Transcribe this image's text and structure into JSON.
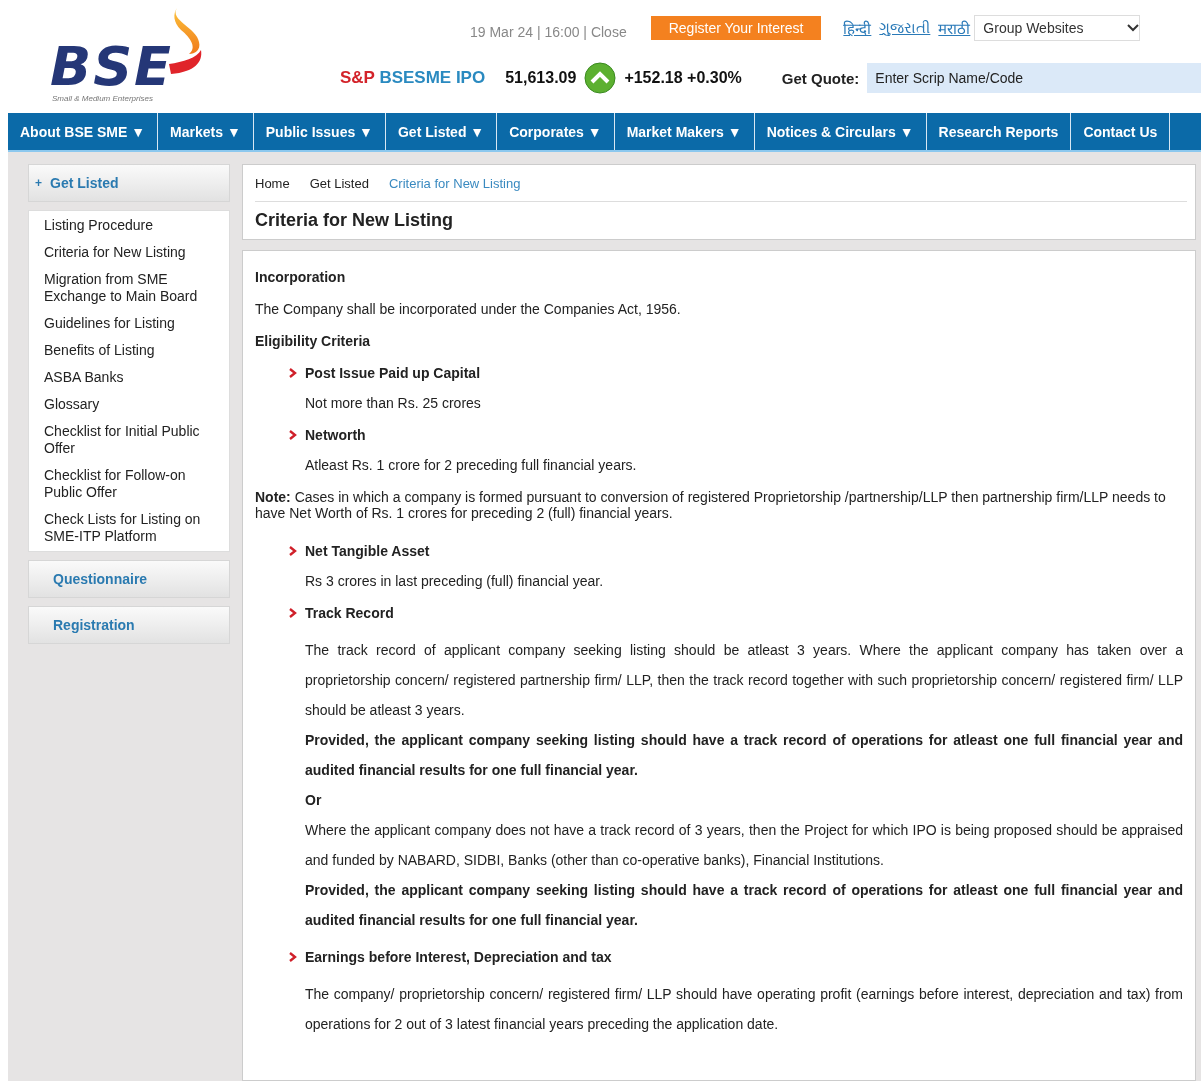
{
  "header": {
    "logo": {
      "wordmark": "BSE",
      "tagline": "Small & Medium Enterprises"
    },
    "market_status": "19 Mar 24 | 16:00 | Close",
    "register_button": "Register Your Interest",
    "language_links": [
      "हिन्दी",
      "ગુજરાતી",
      "मराठी"
    ],
    "group_websites": "Group Websites",
    "index": {
      "prefix": "S&P",
      "name": "BSESME IPO",
      "value": "51,613.09",
      "rising": true,
      "change": "+152.18 +0.30%"
    },
    "quote": {
      "label": "Get Quote:",
      "placeholder": "Enter Scrip Name/Code"
    }
  },
  "nav": [
    "About BSE SME ▼",
    "Markets ▼",
    "Public Issues ▼",
    "Get Listed ▼",
    "Corporates ▼",
    "Market Makers ▼",
    "Notices & Circulars ▼",
    "Research Reports",
    "Contact Us"
  ],
  "sidebar": {
    "section": {
      "marker": "+",
      "title": "Get Listed",
      "expanded": true
    },
    "items": [
      {
        "label": "Listing Procedure",
        "selected": false
      },
      {
        "label": "Criteria for New Listing",
        "selected": false
      },
      {
        "label": "Migration from SME Exchange to Main Board",
        "selected": false
      },
      {
        "label": "Guidelines for Listing",
        "selected": false
      },
      {
        "label": "Benefits of Listing",
        "selected": false
      },
      {
        "label": "ASBA Banks",
        "selected": false
      },
      {
        "label": "Glossary",
        "selected": false
      },
      {
        "label": "Checklist for Initial Public Offer",
        "selected": false
      },
      {
        "label": "Checklist for Follow-on Public Offer",
        "selected": false
      },
      {
        "label": "Check Lists for Listing on SME-ITP Platform",
        "selected": false
      }
    ],
    "other_sections": [
      "Questionnaire",
      "Registration"
    ]
  },
  "breadcrumb": [
    {
      "label": "Home",
      "current": false
    },
    {
      "label": "Get Listed",
      "current": false
    },
    {
      "label": "Criteria for New Listing",
      "current": true
    }
  ],
  "page_title": "Criteria for New Listing",
  "content": [
    {
      "kind": "heading",
      "text": "Incorporation"
    },
    {
      "kind": "para",
      "text": "The Company shall be incorporated under the Companies Act, 1956."
    },
    {
      "kind": "heading",
      "text": "Eligibility Criteria"
    },
    {
      "kind": "bullet",
      "text": "Post Issue Paid up Capital"
    },
    {
      "kind": "detail",
      "text": "Not more than Rs. 25 crores"
    },
    {
      "kind": "bullet",
      "text": "Networth"
    },
    {
      "kind": "detail",
      "text": "Atleast Rs. 1 crore for 2 preceding full financial years."
    },
    {
      "kind": "note",
      "text": "**Note:** Cases in which a company is formed pursuant to conversion of registered Proprietorship /partnership/LLP then partnership firm/LLP needs to have Net Worth of Rs. 1 crores for preceding 2 (full) financial years."
    },
    {
      "kind": "bullet",
      "text": "Net Tangible Asset"
    },
    {
      "kind": "detail",
      "text": "Rs 3 crores in last preceding (full) financial year."
    },
    {
      "kind": "bullet",
      "text": "Track Record"
    },
    {
      "kind": "body",
      "text": "The track record of applicant company seeking listing should be atleast 3 years. Where the applicant company has taken over a proprietorship concern/ registered partnership firm/ LLP, then the track record together with such proprietorship concern/ registered firm/ LLP should be atleast 3 years."
    },
    {
      "kind": "strong",
      "text": "Provided, the applicant company seeking listing should have a track record of operations for atleast one full financial year and audited financial results for one full financial year."
    },
    {
      "kind": "strong",
      "text": "Or"
    },
    {
      "kind": "body",
      "text": "Where the applicant company does not have a track record of 3 years, then the Project for which IPO is being proposed should be appraised and funded by NABARD, SIDBI, Banks (other than co-operative banks), Financial Institutions."
    },
    {
      "kind": "strong",
      "text": "Provided, the applicant company seeking listing should have a track record of operations for atleast one full financial year and audited financial results for one full financial year."
    },
    {
      "kind": "bullet",
      "text": "Earnings before Interest, Depreciation and tax"
    },
    {
      "kind": "body",
      "text": "The company/ proprietorship concern/ registered firm/ LLP should have operating profit (earnings before interest, depreciation and tax) from operations for 2 out of 3 latest financial years preceding the application date."
    }
  ]
}
